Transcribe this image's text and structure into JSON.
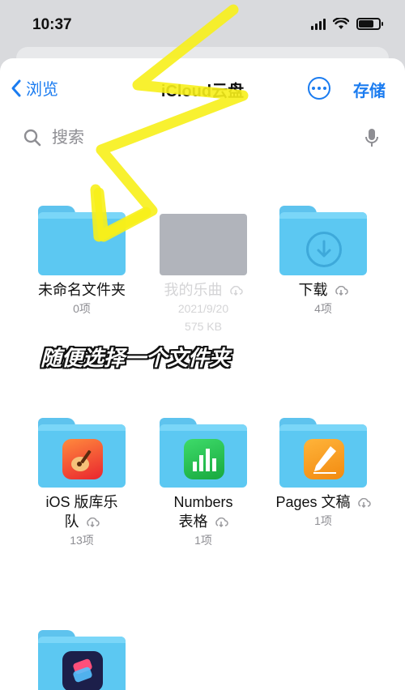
{
  "status_bar": {
    "time": "10:37"
  },
  "nav": {
    "back_label": "浏览",
    "title": "iCloud云盘",
    "save_label": "存储"
  },
  "search": {
    "placeholder": "搜索"
  },
  "items": [
    {
      "name": "未命名文件夹",
      "meta": "0项"
    },
    {
      "name": "我的乐曲",
      "meta1": "2021/9/20",
      "meta2": "575 KB"
    },
    {
      "name": "下载",
      "meta": "4项"
    },
    {
      "name_line1": "iOS 版库乐",
      "name_line2": "队",
      "meta": "13项"
    },
    {
      "name_line1": "Numbers",
      "name_line2": "表格",
      "meta": "1项"
    },
    {
      "name": "Pages 文稿",
      "meta": "1项"
    }
  ],
  "annotation": {
    "caption": "随便选择一个文件夹",
    "color": "#f7ef1a"
  },
  "colors": {
    "accent": "#1b7cf0",
    "folder": "#5cc8f2"
  }
}
